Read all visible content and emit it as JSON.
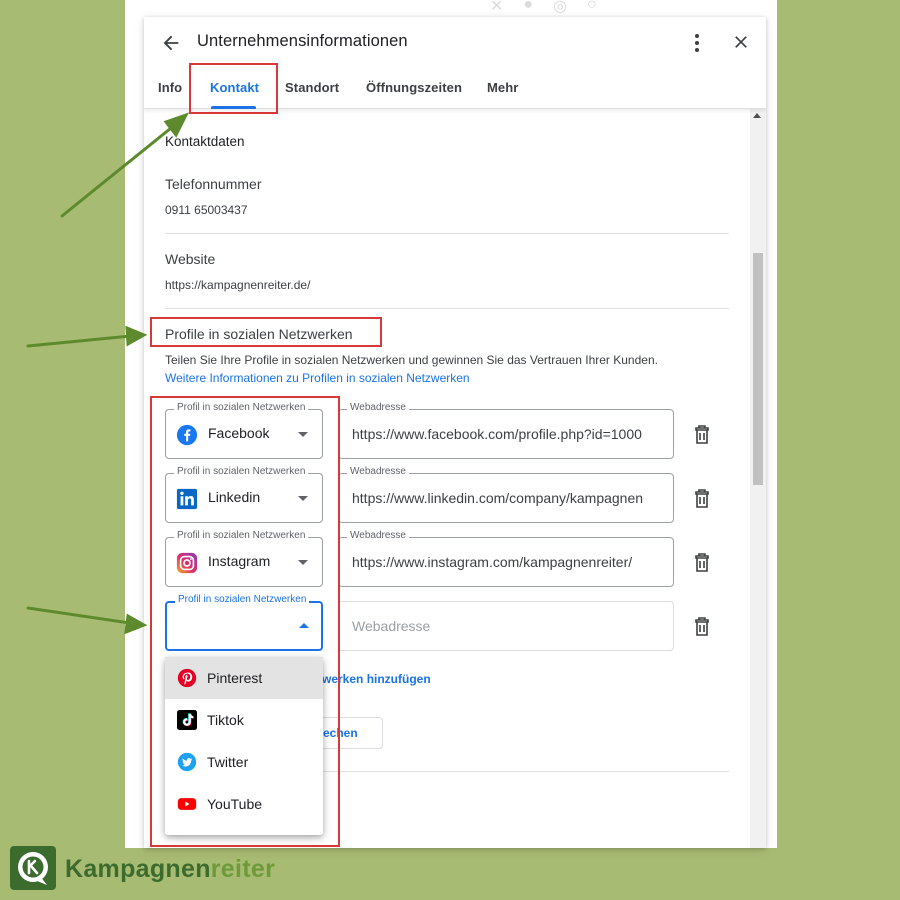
{
  "dialog": {
    "title": "Unternehmensinformationen",
    "tabs": [
      {
        "label": "Info"
      },
      {
        "label": "Kontakt",
        "active": true
      },
      {
        "label": "Standort"
      },
      {
        "label": "Öffnungszeiten"
      },
      {
        "label": "Mehr"
      }
    ]
  },
  "contact": {
    "section_title": "Kontaktdaten",
    "phone": {
      "label": "Telefonnummer",
      "value": "0911 65003437"
    },
    "website": {
      "label": "Website",
      "value": "https://kampagnenreiter.de/"
    }
  },
  "social": {
    "title": "Profile in sozialen Netzwerken",
    "description": "Teilen Sie Ihre Profile in sozialen Netzwerken und gewinnen Sie das Vertrauen Ihrer Kunden.",
    "more_link": "Weitere Informationen zu Profilen in sozialen Netzwerken",
    "select_label": "Profil in sozialen Netzwerken",
    "url_label": "Webadresse",
    "rows": [
      {
        "network": "Facebook",
        "icon": "facebook-icon",
        "url": "https://www.facebook.com/profile.php?id=1000"
      },
      {
        "network": "Linkedin",
        "icon": "linkedin-icon",
        "url": "https://www.linkedin.com/company/kampagnen"
      },
      {
        "network": "Instagram",
        "icon": "instagram-icon",
        "url": "https://www.instagram.com/kampagnenreiter/"
      }
    ],
    "new_row": {
      "network": "",
      "url_placeholder": "Webadresse"
    },
    "add_link_partial": "werken hinzufügen",
    "button_partial": "echen"
  },
  "dropdown": {
    "options": [
      {
        "label": "Pinterest",
        "icon": "pinterest-icon",
        "highlighted": true
      },
      {
        "label": "Tiktok",
        "icon": "tiktok-icon"
      },
      {
        "label": "Twitter",
        "icon": "twitter-icon"
      },
      {
        "label": "YouTube",
        "icon": "youtube-icon"
      }
    ]
  },
  "brand": {
    "part1": "Kampagnen",
    "part2": "reiter"
  },
  "colors": {
    "background": "#a8bb72",
    "accent": "#1a73e8",
    "annotation_red": "#d93838",
    "arrow_green": "#5e8a2e",
    "brand_dark": "#3c6b2e",
    "brand_light": "#6d9b3a"
  }
}
